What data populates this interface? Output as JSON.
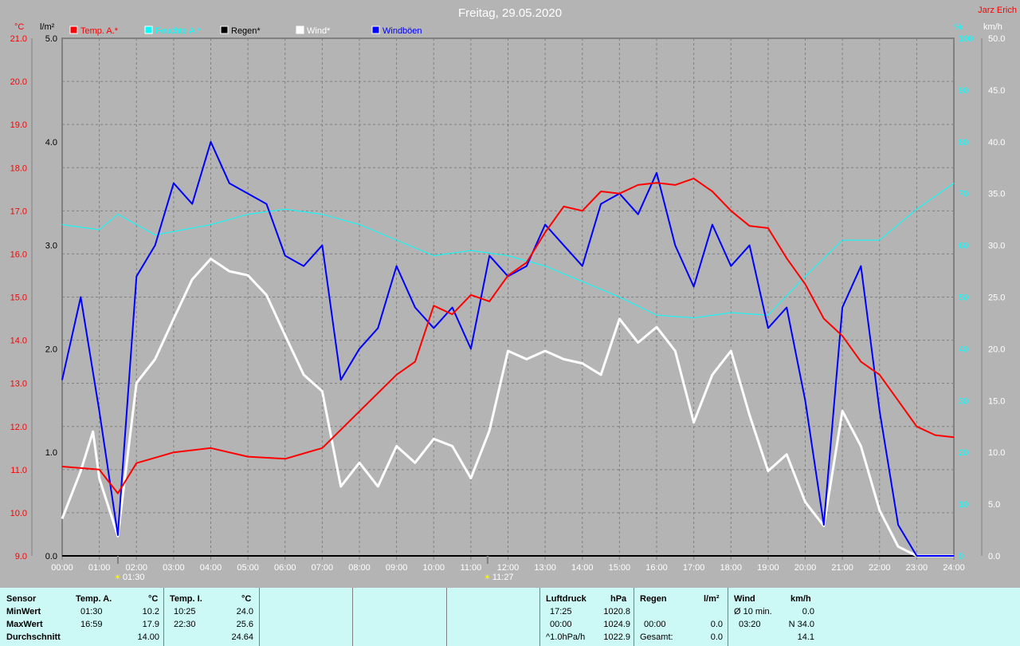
{
  "title": "Freitag, 29.05.2020",
  "author": "Jarz Erich",
  "colors": {
    "temp": "#ff0000",
    "hum": "#00ffff",
    "rain": "#000000",
    "wind": "#ffffff",
    "gust": "#0000ff",
    "bg": "#b4b4b4"
  },
  "chart_data": {
    "type": "line",
    "title": "Freitag, 29.05.2020",
    "axes": {
      "temp": {
        "unit": "°C",
        "range": [
          9,
          21
        ],
        "ticks": [
          "9.0",
          "10.0",
          "11.0",
          "12.0",
          "13.0",
          "14.0",
          "15.0",
          "16.0",
          "17.0",
          "18.0",
          "19.0",
          "20.0",
          "21.0"
        ]
      },
      "rain": {
        "unit": "l/m²",
        "range": [
          0,
          5
        ],
        "ticks": [
          "0.0",
          "1.0",
          "2.0",
          "3.0",
          "4.0",
          "5.0"
        ]
      },
      "hum": {
        "unit": "%",
        "range": [
          0,
          100
        ],
        "ticks": [
          "0",
          "10",
          "20",
          "30",
          "40",
          "50",
          "60",
          "70",
          "80",
          "90",
          "100"
        ]
      },
      "wind": {
        "unit": "km/h",
        "range": [
          0,
          50
        ],
        "ticks": [
          "0.0",
          "5.0",
          "10.0",
          "15.0",
          "20.0",
          "25.0",
          "30.0",
          "35.0",
          "40.0",
          "45.0",
          "50.0"
        ]
      },
      "x": {
        "range": [
          0,
          24
        ],
        "ticks": [
          "00:00",
          "01:00",
          "02:00",
          "03:00",
          "04:00",
          "05:00",
          "06:00",
          "07:00",
          "08:00",
          "09:00",
          "10:00",
          "11:00",
          "12:00",
          "13:00",
          "14:00",
          "15:00",
          "16:00",
          "17:00",
          "18:00",
          "19:00",
          "20:00",
          "21:00",
          "22:00",
          "23:00",
          "24:00"
        ]
      }
    },
    "legend": [
      "Temp. A.*",
      "Feuchte A.*",
      "Regen*",
      "Wind*",
      "Windböen"
    ],
    "markers": [
      {
        "time": "01:30",
        "x": 1.5
      },
      {
        "time": "11:27",
        "x": 11.45
      }
    ],
    "series": [
      {
        "name": "Temp. A.",
        "axis": "temp",
        "x": [
          0,
          1,
          1.5,
          2,
          3,
          4,
          5,
          6,
          7,
          8,
          9,
          9.5,
          10,
          10.5,
          11,
          11.5,
          12,
          12.5,
          13,
          13.5,
          14,
          14.5,
          15,
          15.5,
          16,
          16.5,
          17,
          17.5,
          18,
          18.5,
          19,
          19.5,
          20,
          20.5,
          21,
          21.5,
          22,
          22.5,
          23,
          23.5,
          24
        ],
        "y": [
          11.07,
          11.0,
          10.45,
          11.15,
          11.4,
          11.5,
          11.3,
          11.25,
          11.5,
          12.35,
          13.2,
          13.5,
          14.8,
          14.6,
          15.05,
          14.9,
          15.5,
          15.8,
          16.5,
          17.1,
          17.0,
          17.45,
          17.4,
          17.6,
          17.65,
          17.6,
          17.75,
          17.45,
          17.0,
          16.65,
          16.6,
          15.9,
          15.3,
          14.5,
          14.1,
          13.5,
          13.2,
          12.6,
          12.0,
          11.8,
          11.75
        ]
      },
      {
        "name": "Feuchte A.",
        "axis": "hum",
        "x": [
          0,
          1,
          1.5,
          2.5,
          4,
          5,
          6,
          7,
          8,
          9,
          10,
          11,
          12,
          13,
          14,
          15,
          16,
          17,
          18,
          19,
          20,
          21,
          22,
          23,
          24
        ],
        "y": [
          64,
          63,
          66,
          62,
          64,
          66,
          67,
          66,
          64,
          61,
          58,
          59,
          58,
          56,
          53,
          50,
          46.5,
          46,
          47,
          46.5,
          54,
          61,
          61,
          67,
          72
        ]
      },
      {
        "name": "Regen",
        "axis": "rain",
        "x": [
          0,
          24
        ],
        "y": [
          0,
          0
        ]
      },
      {
        "name": "Wind",
        "axis": "wind",
        "x": [
          0,
          0.5,
          0.83,
          1,
          1.5,
          2,
          2.5,
          3,
          3.5,
          4,
          4.5,
          5,
          5.5,
          6,
          6.5,
          7,
          7.5,
          8,
          8.5,
          9,
          9.5,
          10,
          10.5,
          11,
          11.5,
          12,
          12.5,
          13,
          13.5,
          14,
          14.5,
          15,
          15.5,
          16,
          16.5,
          17,
          17.5,
          18,
          18.5,
          19,
          19.5,
          20,
          20.5,
          21,
          21.5,
          22,
          22.5,
          23,
          24
        ],
        "y": [
          3.6,
          8.2,
          12,
          7.5,
          1.9,
          16.7,
          19,
          22.9,
          26.7,
          28.7,
          27.5,
          27.1,
          25.2,
          21.3,
          17.5,
          15.9,
          6.7,
          9,
          6.7,
          10.6,
          9,
          11.3,
          10.6,
          7.5,
          12.1,
          19.8,
          19,
          19.8,
          19,
          18.6,
          17.5,
          22.9,
          20.6,
          22.1,
          19.8,
          12.9,
          17.5,
          19.8,
          13.6,
          8.2,
          9.8,
          5.2,
          2.9,
          14,
          10.6,
          4.4,
          0.9,
          0,
          0
        ]
      },
      {
        "name": "Windböen",
        "axis": "wind",
        "x": [
          0,
          0.5,
          1,
          1.5,
          2,
          2.5,
          3,
          3.5,
          4,
          4.5,
          5,
          5.5,
          6,
          6.5,
          7,
          7.5,
          8,
          8.5,
          9,
          9.5,
          10,
          10.5,
          11,
          11.5,
          12,
          12.5,
          13,
          13.5,
          14,
          14.5,
          15,
          15.5,
          16,
          16.5,
          17,
          17.5,
          18,
          18.5,
          19,
          19.5,
          20,
          20.5,
          21,
          21.5,
          22,
          22.5,
          23,
          23.5,
          24
        ],
        "y": [
          17,
          25,
          14,
          2,
          27,
          30,
          36,
          34,
          40,
          36,
          35,
          34,
          29,
          28,
          30,
          17,
          20,
          22,
          28,
          24,
          22,
          24,
          20,
          29,
          27,
          28,
          32,
          30,
          28,
          34,
          35,
          33,
          37,
          30,
          26,
          32,
          28,
          30,
          22,
          24,
          15,
          3,
          24,
          28,
          14,
          3,
          0,
          0,
          0
        ]
      }
    ]
  },
  "table": {
    "sensor": {
      "h": "Sensor",
      "min": "MinWert",
      "max": "MaxWert",
      "avg": "Durchschnitt"
    },
    "tempA": {
      "h": "Temp. A.",
      "u": "°C",
      "min_t": "01:30",
      "min_v": "10.2",
      "max_t": "16:59",
      "max_v": "17.9",
      "avg": "14.00"
    },
    "tempI": {
      "h": "Temp. I.",
      "u": "°C",
      "min_t": "10:25",
      "min_v": "24.0",
      "max_t": "22:30",
      "max_v": "25.6",
      "avg": "24.64"
    },
    "press": {
      "h": "Luftdruck",
      "u": "hPa",
      "min_t": "17:25",
      "min_v": "1020.8",
      "max_t": "00:00",
      "max_v": "1024.9",
      "trend": "^1.0hPa/h",
      "avg": "1022.9"
    },
    "rain": {
      "h": "Regen",
      "u": "l/m²",
      "max_t": "00:00",
      "max_v": "0.0",
      "total_l": "Gesamt:",
      "total": "0.0"
    },
    "wind": {
      "h": "Wind",
      "u": "km/h",
      "avg10_l": "Ø 10 min.",
      "avg10": "0.0",
      "max_t": "03:20",
      "max_v": "N 34.0",
      "avg": "14.1"
    }
  }
}
